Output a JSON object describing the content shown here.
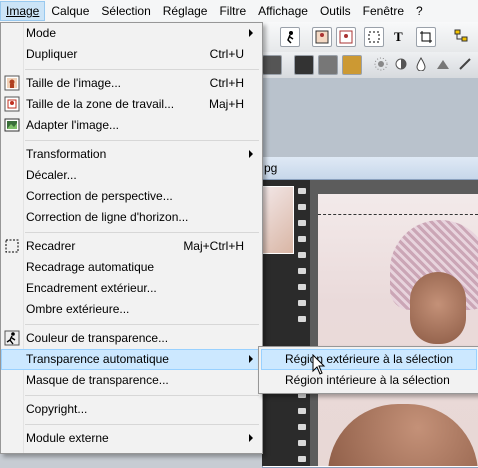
{
  "menubar": {
    "items": [
      "Image",
      "Calque",
      "Sélection",
      "Réglage",
      "Filtre",
      "Affichage",
      "Outils",
      "Fenêtre",
      "?"
    ]
  },
  "document": {
    "title_fragment": "pg"
  },
  "image_menu": {
    "items": [
      {
        "label": "Mode",
        "shortcut": "",
        "submenu": true
      },
      {
        "label": "Dupliquer",
        "shortcut": "Ctrl+U"
      },
      {
        "label": "Taille de l'image...",
        "shortcut": "Ctrl+H",
        "icon": "image-size-icon"
      },
      {
        "label": "Taille de la zone de travail...",
        "shortcut": "Maj+H",
        "icon": "canvas-size-icon"
      },
      {
        "label": "Adapter l'image...",
        "shortcut": "",
        "icon": "fit-image-icon"
      },
      {
        "label": "Transformation",
        "shortcut": "",
        "submenu": true
      },
      {
        "label": "Décaler...",
        "shortcut": ""
      },
      {
        "label": "Correction de perspective...",
        "shortcut": ""
      },
      {
        "label": "Correction de ligne d'horizon...",
        "shortcut": ""
      },
      {
        "label": "Recadrer",
        "shortcut": "Maj+Ctrl+H",
        "icon": "crop-icon"
      },
      {
        "label": "Recadrage automatique",
        "shortcut": ""
      },
      {
        "label": "Encadrement extérieur...",
        "shortcut": ""
      },
      {
        "label": "Ombre extérieure...",
        "shortcut": ""
      },
      {
        "label": "Couleur de transparence...",
        "shortcut": "",
        "icon": "transparency-color-icon"
      },
      {
        "label": "Transparence automatique",
        "shortcut": "",
        "submenu": true,
        "highlighted": true
      },
      {
        "label": "Masque de transparence...",
        "shortcut": ""
      },
      {
        "label": "Copyright...",
        "shortcut": ""
      },
      {
        "label": "Module externe",
        "shortcut": "",
        "submenu": true
      }
    ]
  },
  "submenu": {
    "items": [
      {
        "label": "Région extérieure à la sélection",
        "highlighted": true
      },
      {
        "label": "Région intérieure à la sélection"
      }
    ]
  },
  "colors": {
    "highlight": "#cce8ff",
    "highlight_border": "#99d1ff",
    "menu_bg": "#f2f2f2"
  }
}
